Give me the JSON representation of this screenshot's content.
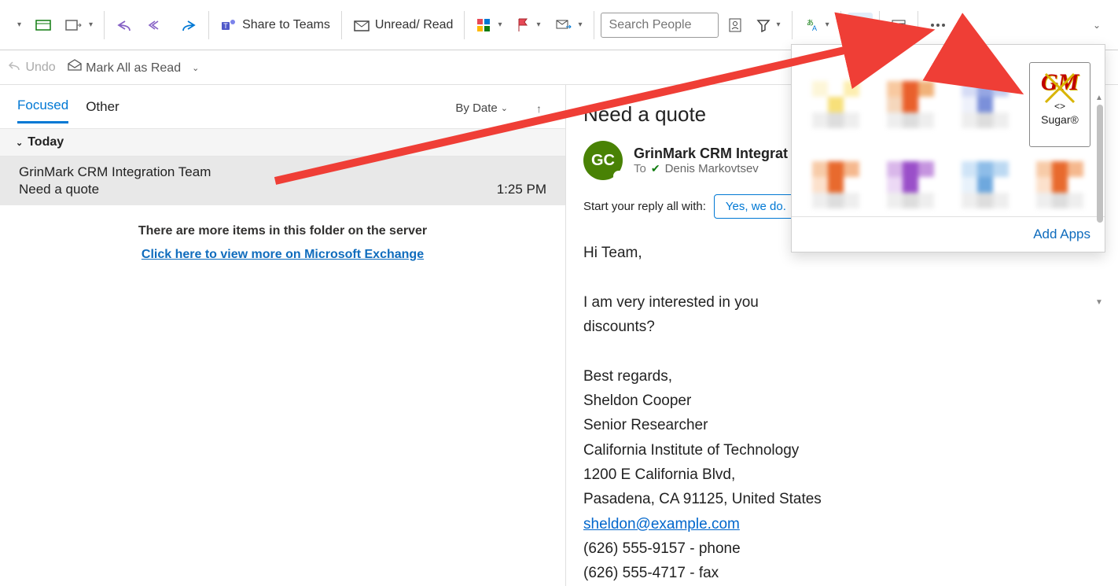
{
  "ribbon": {
    "share_teams": "Share to Teams",
    "unread_read": "Unread/ Read",
    "search_placeholder": "Search People"
  },
  "actionbar": {
    "undo": "Undo",
    "mark_all": "Mark All as Read"
  },
  "tabs": {
    "focused": "Focused",
    "other": "Other",
    "sort": "By Date"
  },
  "group": {
    "today": "Today"
  },
  "email": {
    "from": "GrinMark CRM Integration Team",
    "subject": "Need a quote",
    "time": "1:25 PM"
  },
  "list_footer": {
    "more": "There are more items in this folder on the server",
    "view_more": "Click here to view more on Microsoft Exchange"
  },
  "reading": {
    "subject": "Need a quote",
    "avatar_initials": "GC",
    "from_name": "GrinMark CRM Integrat",
    "to_label": "To",
    "to_name": "Denis Markovtsev",
    "reply_prefix": "Start your reply all with:",
    "reply_suggestion": "Yes, we do.",
    "greeting": "Hi Team,",
    "line1": "I am very interested in you",
    "line2": "discounts?",
    "signoff": "Best regards,",
    "sig_name": "Sheldon Cooper",
    "sig_title": "Senior Researcher",
    "sig_org": "California Institute of Technology",
    "sig_addr1": "1200 E California Blvd,",
    "sig_addr2": "Pasadena, CA 91125, United States",
    "sig_email": "sheldon@example.com",
    "sig_phone": "(626) 555-9157 - phone",
    "sig_fax": "(626) 555-4717 - fax"
  },
  "addins": {
    "sugar_code": "<>",
    "sugar_name": "Sugar®",
    "add_apps": "Add Apps"
  }
}
